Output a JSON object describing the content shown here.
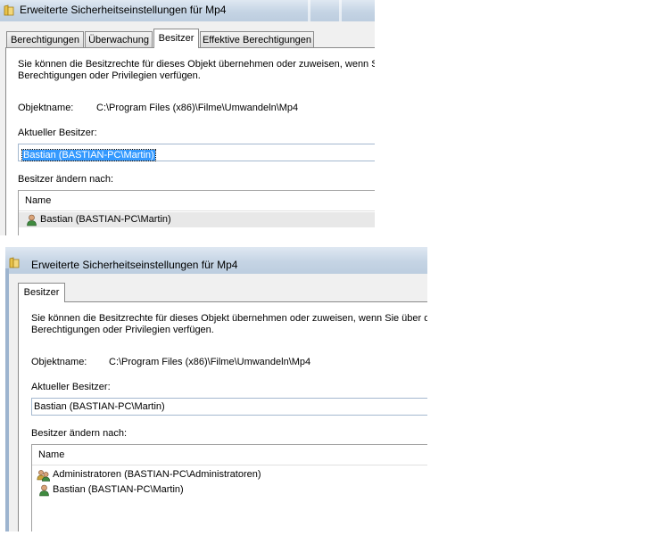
{
  "window1": {
    "title": "Erweiterte Sicherheitseinstellungen für Mp4",
    "tabs": [
      "Berechtigungen",
      "Überwachung",
      "Besitzer",
      "Effektive Berechtigungen"
    ],
    "description_line1": "Sie können die Besitzrechte für dieses Objekt übernehmen oder zuweisen, wenn Sie",
    "description_line2": "Berechtigungen oder Privilegien verfügen.",
    "object_label": "Objektname:",
    "object_value": "C:\\Program Files (x86)\\Filme\\Umwandeln\\Mp4",
    "owner_label": "Aktueller Besitzer:",
    "owner_value": "Bastian (BASTIAN-PC\\Martin)",
    "change_label": "Besitzer ändern nach:",
    "list_header": "Name",
    "list_items": [
      "Bastian (BASTIAN-PC\\Martin)"
    ]
  },
  "window2": {
    "title": "Erweiterte Sicherheitseinstellungen für Mp4",
    "tabs": [
      "Besitzer"
    ],
    "description_line1": "Sie können die Besitzrechte für dieses Objekt übernehmen oder zuweisen, wenn Sie über die e",
    "description_line2": "Berechtigungen oder Privilegien verfügen.",
    "object_label": "Objektname:",
    "object_value": "C:\\Program Files (x86)\\Filme\\Umwandeln\\Mp4",
    "owner_label": "Aktueller Besitzer:",
    "owner_value": "Bastian (BASTIAN-PC\\Martin)",
    "change_label": "Besitzer ändern nach:",
    "list_header": "Name",
    "list_items": [
      "Administratoren (BASTIAN-PC\\Administratoren)",
      "Bastian (BASTIAN-PC\\Martin)"
    ]
  },
  "icons": {
    "title": "folder-icon",
    "user": "user-icon",
    "group": "group-icon"
  },
  "colors": {
    "selection": "#3399ff",
    "titlebar": "#c5d4e4"
  }
}
